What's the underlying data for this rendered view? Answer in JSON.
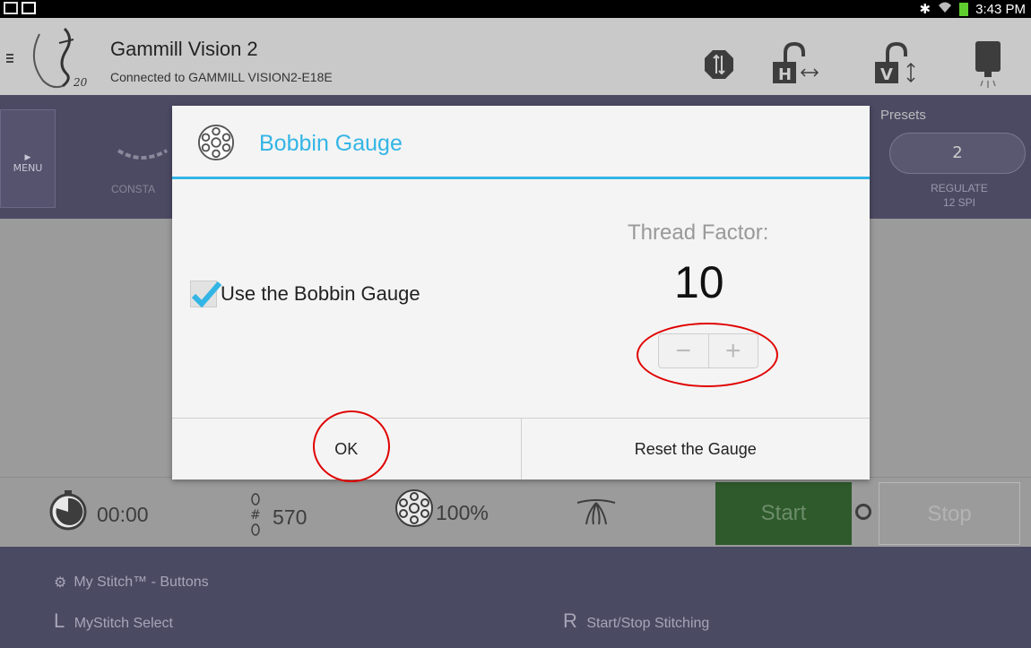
{
  "status_bar": {
    "time": "3:43 PM",
    "icons": [
      "gallery-icon",
      "cast-icon",
      "bluetooth-icon",
      "wifi-icon",
      "battery-icon"
    ]
  },
  "app": {
    "title": "Gammill Vision 2",
    "subtitle": "Connected to GAMMILL VISION2-E18E",
    "header_buttons": [
      "needle-up-down-icon",
      "horizontal-lock-icon",
      "vertical-lock-icon",
      "machine-light-icon"
    ]
  },
  "stitch_bar": {
    "menu_label": "MENU",
    "mode_label": "CONSTA",
    "presets_label": "Presets",
    "preset_value": "2",
    "regulate_label": "REGULATE",
    "regulate_sub": "12 SPI"
  },
  "dialog": {
    "title": "Bobbin Gauge",
    "checkbox_label": "Use the Bobbin Gauge",
    "checkbox_checked": true,
    "thread_factor_label": "Thread Factor:",
    "thread_factor_value": "10",
    "minus_label": "−",
    "plus_label": "+",
    "ok_label": "OK",
    "reset_label": "Reset the Gauge"
  },
  "toolbar": {
    "timer": "00:00",
    "stitch_count": "570",
    "bobbin_percent": "100%",
    "start_label": "Start",
    "stop_label": "Stop"
  },
  "mystitch": {
    "title": "My Stitch™ - Buttons",
    "left_key": "L",
    "left_label": "MyStitch Select",
    "right_key": "R",
    "right_label": "Start/Stop Stitching"
  },
  "colors": {
    "accent": "#33b5e5",
    "stitch_bar": "#4c4a63",
    "start_green": "#2e5a2c",
    "annotation": "#e00000"
  }
}
